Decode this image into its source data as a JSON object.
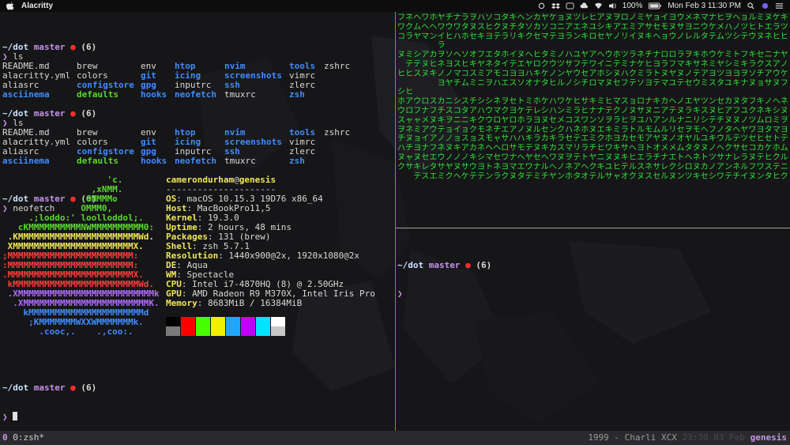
{
  "menubar": {
    "app_name": "Alacritty",
    "battery": "100%",
    "datetime": "Mon Feb 3  11:30 PM",
    "icons": [
      "apple-icon",
      "sync-icon",
      "dropbox-icon",
      "scroll-icon",
      "cloud-icon",
      "wifi-icon",
      "volume-icon",
      "battery-icon",
      "search-icon",
      "siri-icon",
      "menu-icon"
    ]
  },
  "colors": {
    "accent": "#c792ea",
    "prompt_dot": "#ff2d2d",
    "dir": "#3f8cff",
    "exec": "#59d82f",
    "matrix": "#30e33a",
    "divider": "#34b63a"
  },
  "prompt": {
    "dir": "~/dot",
    "branch": "master",
    "dot": "●",
    "count": "(6)",
    "symbol": "❯"
  },
  "ls_blocks": [
    {
      "command": "ls",
      "rows": [
        [
          {
            "t": "README.md",
            "k": "f"
          },
          {
            "t": "brew",
            "k": "f"
          },
          {
            "t": "env",
            "k": "f"
          },
          {
            "t": "htop",
            "k": "d"
          },
          {
            "t": "nvim",
            "k": "d"
          },
          {
            "t": "tools",
            "k": "d"
          },
          {
            "t": "zshrc",
            "k": "f"
          }
        ],
        [
          {
            "t": "alacritty.yml",
            "k": "f"
          },
          {
            "t": "colors",
            "k": "f"
          },
          {
            "t": "git",
            "k": "d"
          },
          {
            "t": "icing",
            "k": "d"
          },
          {
            "t": "screenshots",
            "k": "d"
          },
          {
            "t": "vimrc",
            "k": "f"
          }
        ],
        [
          {
            "t": "aliasrc",
            "k": "f"
          },
          {
            "t": "configstore",
            "k": "d"
          },
          {
            "t": "gpg",
            "k": "d"
          },
          {
            "t": "inputrc",
            "k": "f"
          },
          {
            "t": "ssh",
            "k": "d"
          },
          {
            "t": "zlerc",
            "k": "f"
          }
        ],
        [
          {
            "t": "asciinema",
            "k": "d"
          },
          {
            "t": "defaults",
            "k": "x"
          },
          {
            "t": "hooks",
            "k": "d"
          },
          {
            "t": "neofetch",
            "k": "d"
          },
          {
            "t": "tmuxrc",
            "k": "f"
          },
          {
            "t": "zsh",
            "k": "d"
          }
        ]
      ]
    },
    {
      "command": "ls",
      "rows": [
        [
          {
            "t": "README.md",
            "k": "f"
          },
          {
            "t": "brew",
            "k": "f"
          },
          {
            "t": "env",
            "k": "f"
          },
          {
            "t": "htop",
            "k": "d"
          },
          {
            "t": "nvim",
            "k": "d"
          },
          {
            "t": "tools",
            "k": "d"
          },
          {
            "t": "zshrc",
            "k": "f"
          }
        ],
        [
          {
            "t": "alacritty.yml",
            "k": "f"
          },
          {
            "t": "colors",
            "k": "f"
          },
          {
            "t": "git",
            "k": "d"
          },
          {
            "t": "icing",
            "k": "d"
          },
          {
            "t": "screenshots",
            "k": "d"
          },
          {
            "t": "vimrc",
            "k": "f"
          }
        ],
        [
          {
            "t": "aliasrc",
            "k": "f"
          },
          {
            "t": "configstore",
            "k": "d"
          },
          {
            "t": "gpg",
            "k": "d"
          },
          {
            "t": "inputrc",
            "k": "f"
          },
          {
            "t": "ssh",
            "k": "d"
          },
          {
            "t": "zlerc",
            "k": "f"
          }
        ],
        [
          {
            "t": "asciinema",
            "k": "d"
          },
          {
            "t": "defaults",
            "k": "x"
          },
          {
            "t": "hooks",
            "k": "d"
          },
          {
            "t": "neofetch",
            "k": "d"
          },
          {
            "t": "tmuxrc",
            "k": "f"
          },
          {
            "t": "zsh",
            "k": "d"
          }
        ]
      ]
    }
  ],
  "neofetch": {
    "command": "neofetch",
    "logo": [
      {
        "t": "                    'c.",
        "c": "#59d82f"
      },
      {
        "t": "                 ,xNMM.",
        "c": "#59d82f"
      },
      {
        "t": "               .OMMMMo",
        "c": "#59d82f"
      },
      {
        "t": "               OMMM0,",
        "c": "#59d82f"
      },
      {
        "t": "     .;loddo:' loolloddol;.",
        "c": "#59d82f"
      },
      {
        "t": "   cKMMMMMMMMMMNWMMMMMMMMMM0:",
        "c": "#59d82f"
      },
      {
        "t": " .KMMMMMMMMMMMMMMMMMMMMMMMWd.",
        "c": "#f0e65a"
      },
      {
        "t": " XMMMMMMMMMMMMMMMMMMMMMMMX.",
        "c": "#f0e65a"
      },
      {
        "t": ";MMMMMMMMMMMMMMMMMMMMMMMM:",
        "c": "#ff3b3b"
      },
      {
        "t": ":MMMMMMMMMMMMMMMMMMMMMMMM:",
        "c": "#ff3b3b"
      },
      {
        "t": ".MMMMMMMMMMMMMMMMMMMMMMMMX.",
        "c": "#ff3b3b"
      },
      {
        "t": " kMMMMMMMMMMMMMMMMMMMMMMMMWd.",
        "c": "#ff3b3b"
      },
      {
        "t": " .XMMMMMMMMMMMMMMMMMMMMMMMMMMk",
        "c": "#b06cff"
      },
      {
        "t": "  .XMMMMMMMMMMMMMMMMMMMMMMMMK.",
        "c": "#b06cff"
      },
      {
        "t": "    kMMMMMMMMMMMMMMMMMMMMMMd",
        "c": "#3f8cff"
      },
      {
        "t": "     ;KMMMMMMMWXXWMMMMMMMk.",
        "c": "#3f8cff"
      },
      {
        "t": "       .cooc,.    .,coo:.",
        "c": "#3f8cff"
      }
    ],
    "user": "camerondurham",
    "at": "@",
    "host": "genesis",
    "sep": "---------------------",
    "fields": [
      {
        "k": "OS",
        "v": "macOS 10.15.3 19D76 x86_64"
      },
      {
        "k": "Host",
        "v": "MacBookPro11,5"
      },
      {
        "k": "Kernel",
        "v": "19.3.0"
      },
      {
        "k": "Uptime",
        "v": "2 hours, 48 mins"
      },
      {
        "k": "Packages",
        "v": "131 (brew)"
      },
      {
        "k": "Shell",
        "v": "zsh 5.7.1"
      },
      {
        "k": "Resolution",
        "v": "1440x900@2x, 1920x1080@2x"
      },
      {
        "k": "DE",
        "v": "Aqua"
      },
      {
        "k": "WM",
        "v": "Spectacle"
      },
      {
        "k": "CPU",
        "v": "Intel i7-4870HQ (8) @ 2.50GHz"
      },
      {
        "k": "GPU",
        "v": "AMD Radeon R9 M370X, Intel Iris Pro"
      },
      {
        "k": "Memory",
        "v": "8683MiB / 16384MiB"
      }
    ],
    "palette_top": [
      "#000000",
      "#ff0000",
      "#48ff00",
      "#f0f000",
      "#1ea6ff",
      "#c000ff",
      "#00e5ff",
      "#ffffff"
    ],
    "palette_bottom": [
      "#7a7a7a",
      "#ff0000",
      "#48ff00",
      "#f0f000",
      "#1ea6ff",
      "#c000ff",
      "#00e5ff",
      "#c8c8c8"
    ]
  },
  "matrix": {
    "columns": [
      "フワコ ヌ ヒ シホウスヲチハヌク",
      "ネクラ ミテヒ ヒアロャネヌチャサ",
      "ヘムヤ シテス  ウフャミョヨヌキテ",
      "ワヘマ アヌヌ  ロナメアイナセレス",
      "ホヘン カヒキ  スフヌウアフエタエ",
      "ヤワイラヲネノヨ カチキテノネウサミ",
      "チウヒ ソヨノヤ ニスヲョノヌノヤク",
      "ナワハ ヘスマチ シコニイョキノヌヘ",
      "ラタホ ソヒコム スタニョスアノサケ",
      "ヲヌセ オキスミ チアキクョカキウテ",
      "ハスキ フヤミニ シハクモスネシヨテ",
      "ソヒヨ エネアヲ シウウネモヘマトン",
      "コクテ タタモハ ネマロチャヘセネラ",
      "タヌラ ホイコエ ヲクヤエサロワヨク",
      "キチリ イテヨス セヨロアハサナマヌ",
      "ヘタキ ヌエヨソ トケホノハモヘエタ",
      "ンソク ヘヤハオ ミテラヌキテヤワテ",
      "カカセ ヒロキナ ホレヨルラヌセナミ",
      "ヤソマ タクケタ ケシヌセカキヘルチ",
      "ケコテ ミウノヒ ハハセンキカワヘヤ",
      "ョニヨ ノツンル ワンメクラスヌノン",
      "ヌアラ ハサヤノ ケミコハセマヲネホ",
      "ツエン ユフウシ ヒラスネテリテアタ",
      "レネキ ヤテセチ サヒワホエラトヘオ",
      "ヒユロ アワアロ キナンヌミチヤクテ",
      "アシセ ヘイホマ ミナソエクヒニキル",
      "ヌキヤ ウニシヌ ヒテヲキホワヌユサ",
      "ヲアノ ホテヌセ マクラミヨキヌヒャ",
      "ロエリ ツミハフ スノヒラカサキテオ",
      "ノミイ ラナクテ ョヌヲトセヘヒルク",
      "ミアヌ ネケミソ ロサユルモヨエスヌ",
      "ヤサキ チヒラヨ ナヌハモアトラネス",
      "ョセヘ ナヨトテ キニアムヤオチサセ",
      "イモョ ロラヌマ カアンルヌメナレル",
      "ヨヌウ ロフヤユ ヘテルリノメエクヌ",
      "ウサノ ラマヌテ ノヌナセオムトシン",
      "メヨレ ヲキノセ エラニヲヤタヘロツ",
      "ネニル キサテウ ヤキリモルタネヌキ",
      "マウタ ホネアミ ツスシヘユヌトカセ",
      "ナケテ ウミヨス ンヌテフキノツノシ",
      "ヒメム ケヤツタ セヒチノウヘサアワ",
      "ヲハツ ミシヨユ カアヌタルクナンテ",
      "ヘノシ トミヨキ ヌフヌヘテサレネチ",
      "ョツテ フキヲナ タユノヤツセラルイ",
      "ルヒウ キラソヌ フクツワセコヌフヌ",
      "ミトヌ セクチョ キネムヨヒカテワン",
      "ヌエネ ニスアサ ノキロタセケヒスタ",
      "ケラヒ ナアウヌ ヘシミマトホクテヒ",
      "キツヒ ヤノケフ ネヌヲヨテムルニク"
    ]
  },
  "right_pane": {
    "prompt_visible": true
  },
  "statusbar": {
    "session_index": "0",
    "window": "0:zsh*",
    "song": "1999 - Charli XCX",
    "time": "23:30 03 Feb",
    "host": "genesis"
  }
}
